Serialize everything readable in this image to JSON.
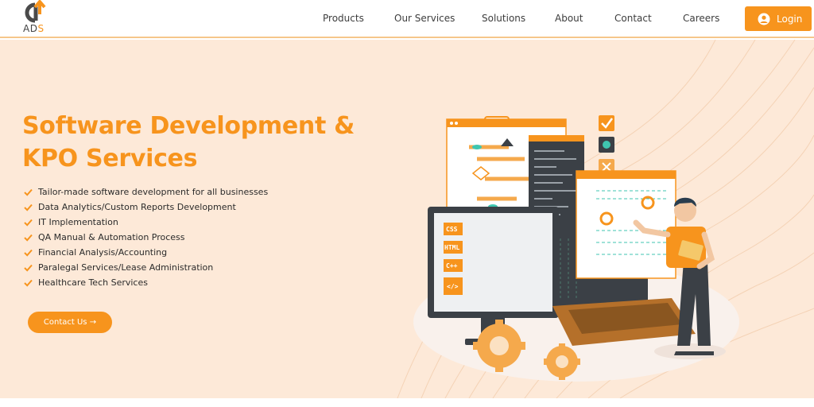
{
  "brand": {
    "logo_text_main": "AD",
    "logo_text_accent": "S"
  },
  "nav": {
    "items": [
      {
        "label": "Products"
      },
      {
        "label": "Our Services"
      },
      {
        "label": "Solutions"
      },
      {
        "label": "About"
      },
      {
        "label": "Contact"
      },
      {
        "label": "Careers"
      }
    ],
    "login_label": "Login"
  },
  "hero": {
    "title": "Software Development & KPO Services",
    "bullets": [
      "Tailor-made software development for all businesses",
      "Data Analytics/Custom Reports Development",
      "IT Implementation",
      "QA Manual & Automation Process",
      "Financial Analysis/Accounting",
      "Paralegal Services/Lease Administration",
      "Healthcare Tech Services"
    ],
    "cta_label": "Contact Us →"
  },
  "illustration": {
    "code_tags": [
      "CSS",
      "HTML",
      "C++",
      "</>"
    ]
  },
  "colors": {
    "accent": "#f7941d",
    "hero_bg": "#fde9d8",
    "dark": "#3b4046"
  }
}
